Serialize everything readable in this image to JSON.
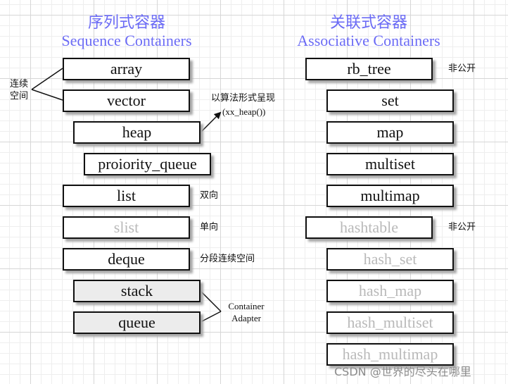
{
  "sequence": {
    "title_cn": "序列式容器",
    "title_en": "Sequence Containers",
    "boxes": [
      {
        "label": "array",
        "state": "normal"
      },
      {
        "label": "vector",
        "state": "normal"
      },
      {
        "label": "heap",
        "state": "normal"
      },
      {
        "label": "proiority_queue",
        "state": "normal"
      },
      {
        "label": "list",
        "state": "normal"
      },
      {
        "label": "slist",
        "state": "dimmed"
      },
      {
        "label": "deque",
        "state": "normal"
      },
      {
        "label": "stack",
        "state": "adapter"
      },
      {
        "label": "queue",
        "state": "adapter"
      }
    ],
    "notes": {
      "contiguous_line1": "连续",
      "contiguous_line2": "空间",
      "heap_note_line1": "以算法形式呈现",
      "heap_note_line2": "(xx_heap())",
      "list_note": "双向",
      "slist_note": "单向",
      "deque_note": "分段连续空间",
      "adapter_line1": "Container",
      "adapter_line2": "Adapter"
    }
  },
  "associative": {
    "title_cn": "关联式容器",
    "title_en": "Associative Containers",
    "boxes": [
      {
        "label": "rb_tree",
        "state": "normal"
      },
      {
        "label": "set",
        "state": "normal"
      },
      {
        "label": "map",
        "state": "normal"
      },
      {
        "label": "multiset",
        "state": "normal"
      },
      {
        "label": "multimap",
        "state": "normal"
      },
      {
        "label": "hashtable",
        "state": "dimmed"
      },
      {
        "label": "hash_set",
        "state": "dimmed"
      },
      {
        "label": "hash_map",
        "state": "dimmed"
      },
      {
        "label": "hash_multiset",
        "state": "dimmed"
      },
      {
        "label": "hash_multimap",
        "state": "dimmed"
      }
    ],
    "notes": {
      "rb_tree_note": "非公开",
      "hashtable_note": "非公开"
    }
  },
  "watermark": "CSDN @世界的尽头在哪里",
  "colors": {
    "title": "#6b6bf5",
    "dimmed_text": "#b9b9b9",
    "adapter_fill": "#ececec"
  }
}
